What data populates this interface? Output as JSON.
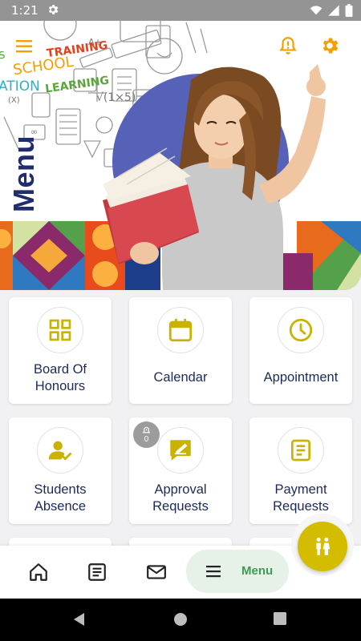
{
  "status_bar": {
    "time": "1:21"
  },
  "hero": {
    "menu_title": "Menu",
    "doodle_words": [
      "TRAINING",
      "SCHOOL",
      "LEARNING",
      "ATION",
      "s"
    ]
  },
  "grid": {
    "cards": [
      {
        "label": "Board Of\nHonours",
        "icon": "grid-icon"
      },
      {
        "label": "Calendar",
        "icon": "calendar-icon"
      },
      {
        "label": "Appointment",
        "icon": "clock-icon"
      },
      {
        "label": "Students\nAbsence",
        "icon": "user-check-icon"
      },
      {
        "label": "Approval\nRequests",
        "icon": "signature-icon",
        "badge": "0"
      },
      {
        "label": "Payment\nRequests",
        "icon": "document-icon"
      }
    ]
  },
  "bottom_nav": {
    "menu_label": "Menu"
  },
  "colors": {
    "accent": "#d4bd00",
    "brand_orange": "#f2a000",
    "nav_green": "#3f9a56",
    "menu_title": "#1f2d6e"
  }
}
